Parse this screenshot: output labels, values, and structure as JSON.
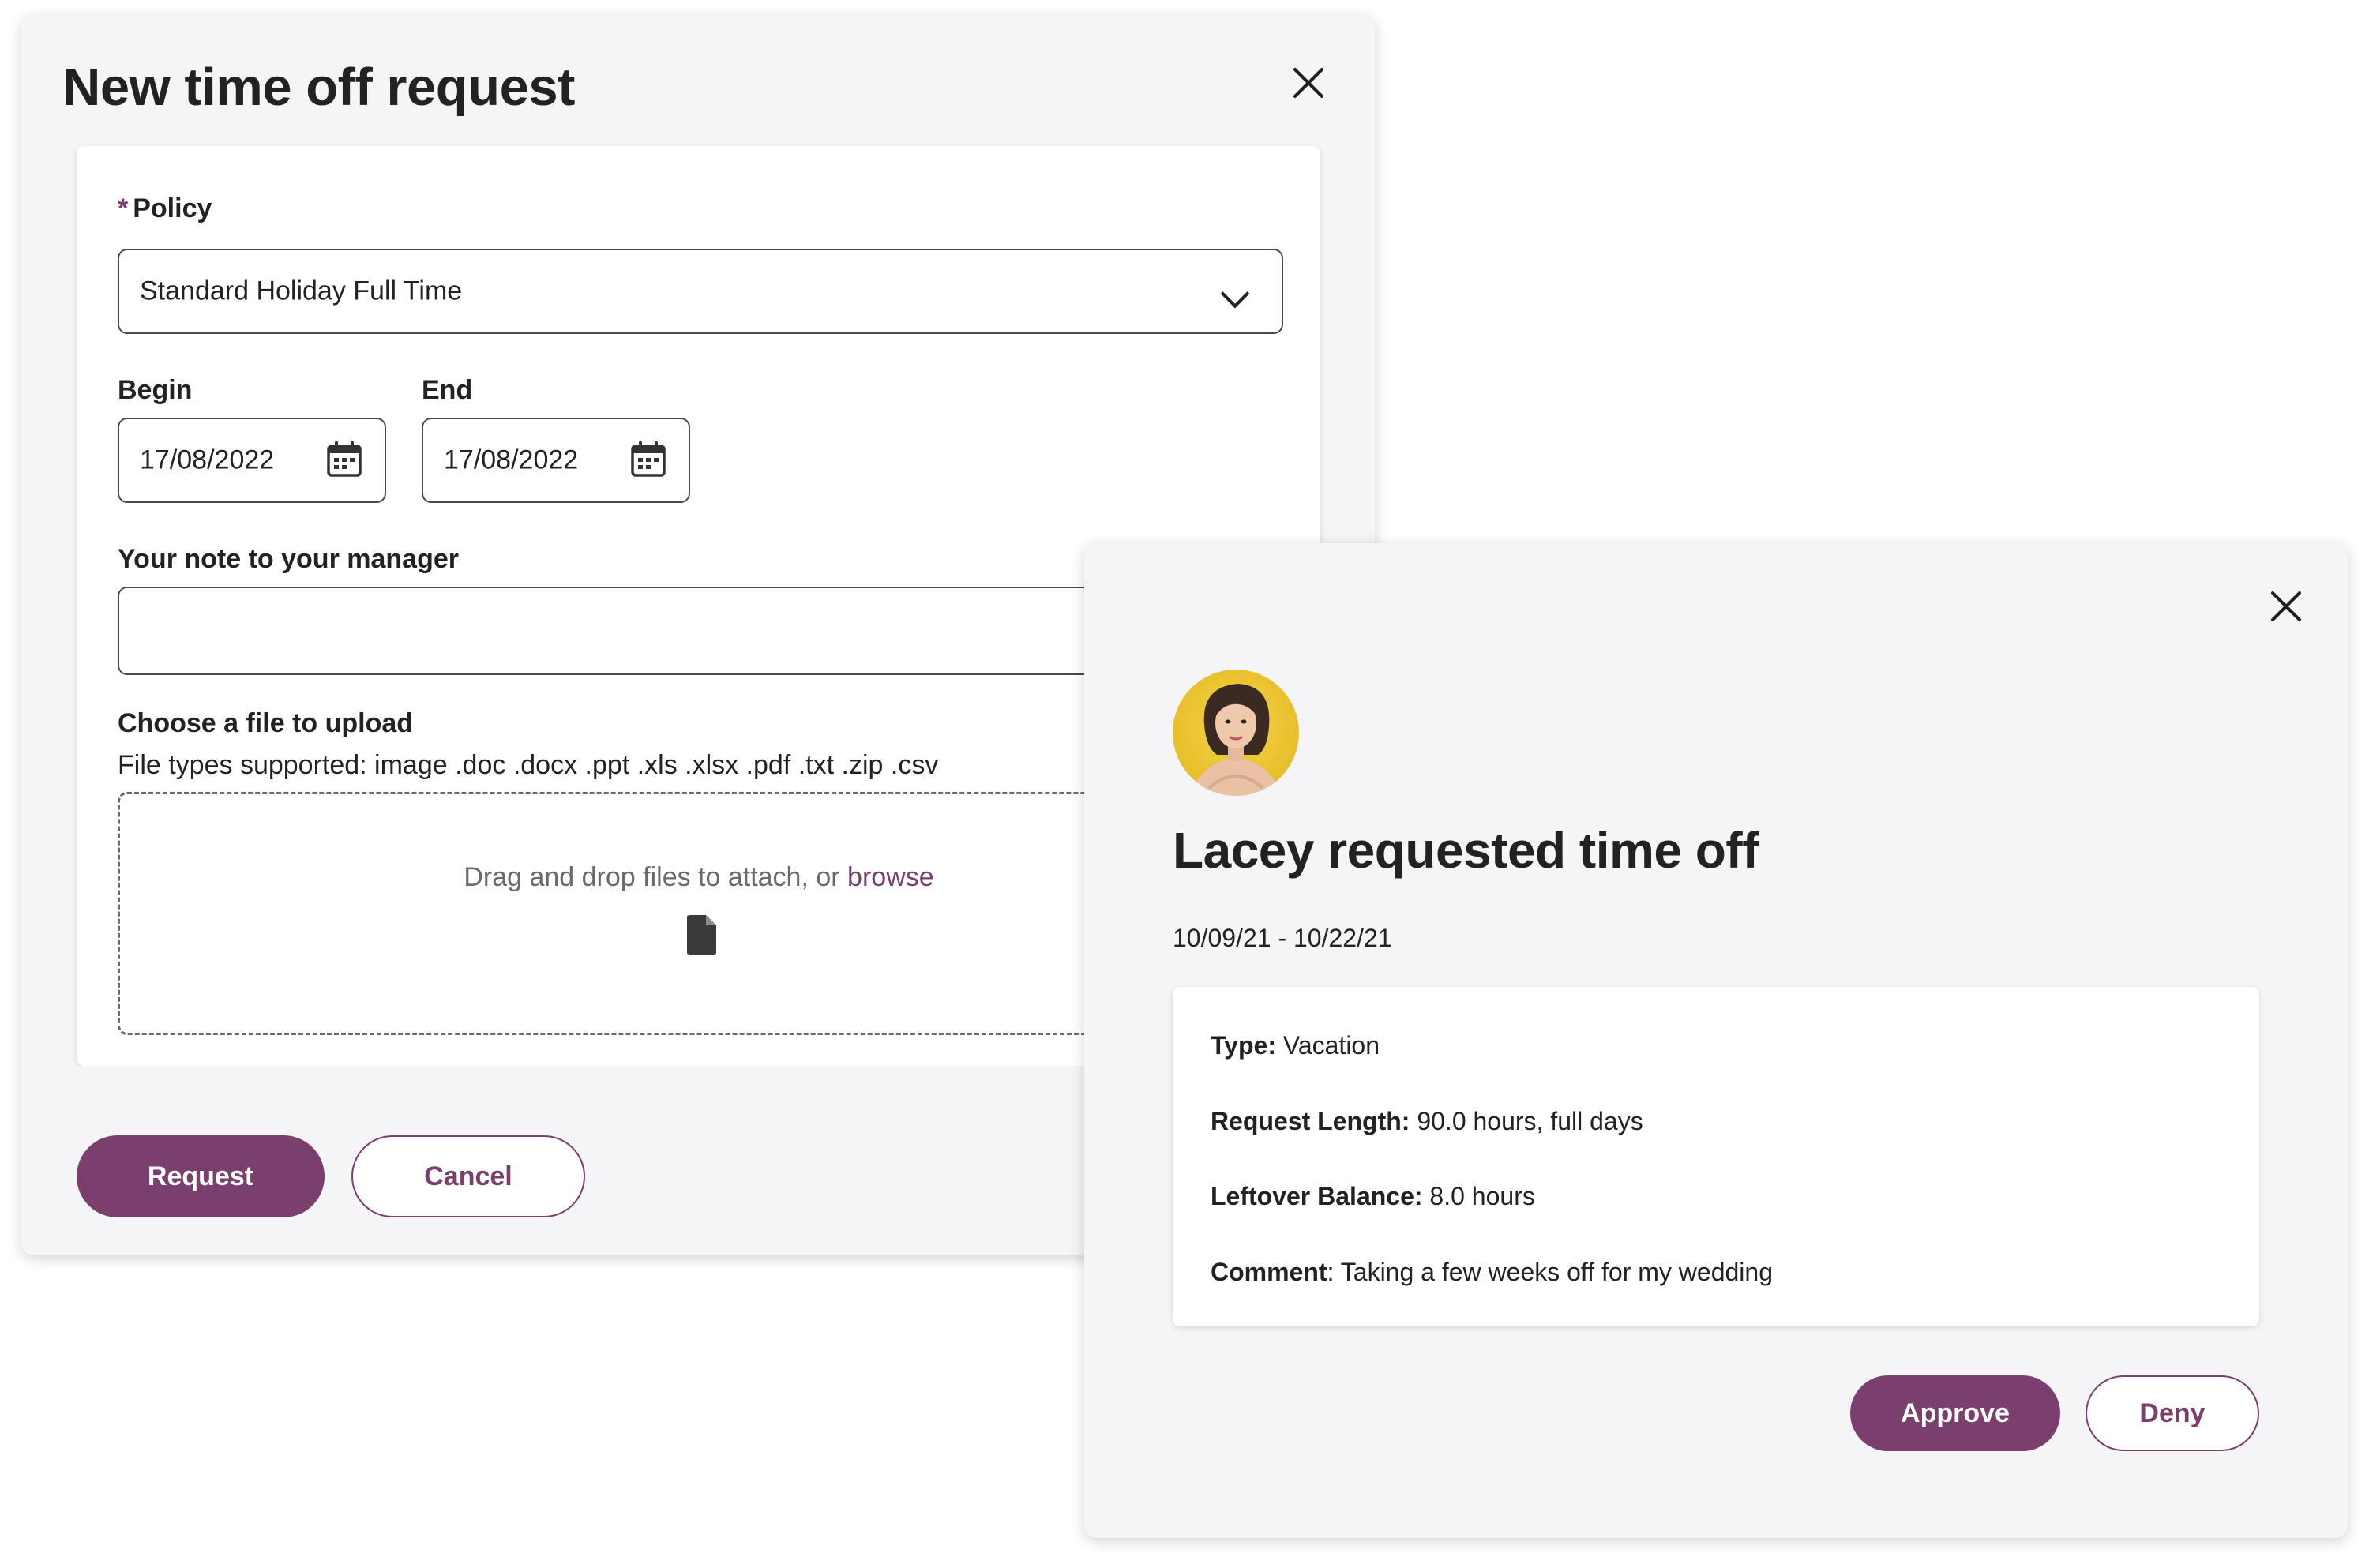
{
  "request_modal": {
    "title": "New time off request",
    "policy": {
      "required_mark": "*",
      "label": "Policy",
      "selected_value": "Standard Holiday Full Time"
    },
    "begin": {
      "label": "Begin",
      "value": "17/08/2022"
    },
    "end": {
      "label": "End",
      "value": "17/08/2022"
    },
    "note": {
      "label": "Your note to your manager",
      "value": ""
    },
    "upload": {
      "label": "Choose a file to upload",
      "file_types": "File types supported: image .doc .docx .ppt .xls .xlsx .pdf .txt .zip .csv",
      "drop_text": "Drag and drop files to attach, or",
      "browse_link": "browse"
    },
    "buttons": {
      "request": "Request",
      "cancel": "Cancel"
    }
  },
  "approval_modal": {
    "title": "Lacey requested time off",
    "date_range": "10/09/21 - 10/22/21",
    "details": [
      {
        "key": "Type:",
        "value": "Vacation"
      },
      {
        "key": "Request Length:",
        "value": "90.0 hours, full days"
      },
      {
        "key": "Leftover Balance:",
        "value": "8.0 hours"
      },
      {
        "key": "Comment",
        "sep": ":",
        "value": "Taking a few weeks off for my wedding"
      }
    ],
    "buttons": {
      "approve": "Approve",
      "deny": "Deny"
    }
  },
  "colors": {
    "accent": "#7b3f6e",
    "panel_bg": "#f5f4f6",
    "avatar_bg": "#e8be2a"
  },
  "icons": [
    "close-icon",
    "chevron-down-icon",
    "calendar-icon",
    "file-icon"
  ]
}
